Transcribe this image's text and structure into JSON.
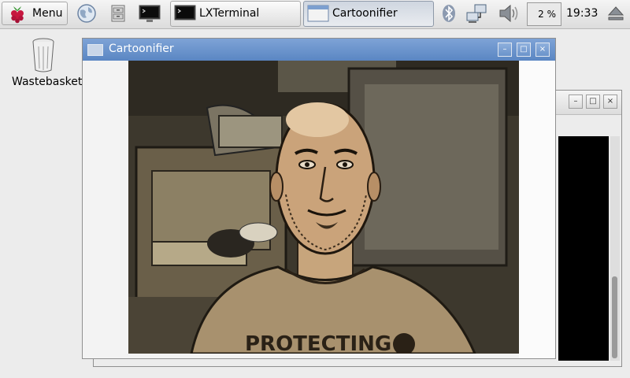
{
  "taskbar": {
    "menu_label": "Menu",
    "launchers": [
      "web-browser",
      "file-manager",
      "terminal"
    ],
    "tasks": [
      {
        "label": "LXTerminal",
        "active": false
      },
      {
        "label": "Cartoonifier",
        "active": true
      }
    ],
    "cpu_percent": "2 %",
    "clock": "19:33"
  },
  "desktop": {
    "icons": [
      {
        "label": "Wastebasket",
        "icon": "trash-icon"
      }
    ]
  },
  "front_window": {
    "title": "Cartoonifier",
    "content": "webcam-cartoon-video",
    "shirt_text": "PROTECTING"
  },
  "back_window": {
    "title": "",
    "content": "terminal"
  },
  "colors": {
    "title_active": "#5a86c3",
    "taskbar": "#e4e4e4",
    "video_bg": "#3f3a2f"
  }
}
